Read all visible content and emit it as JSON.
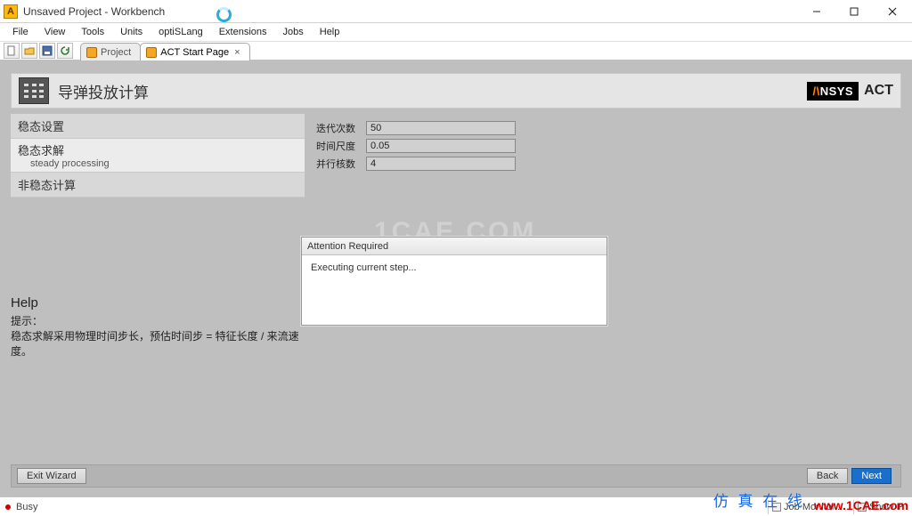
{
  "window": {
    "title": "Unsaved Project - Workbench",
    "app_icon_letter": "A"
  },
  "menu": {
    "file": "File",
    "view": "View",
    "tools": "Tools",
    "units": "Units",
    "optislang": "optiSLang",
    "extensions": "Extensions",
    "jobs": "Jobs",
    "help": "Help"
  },
  "tabs": {
    "project": "Project",
    "act_start": "ACT Start Page"
  },
  "header": {
    "title": "导弹投放计算",
    "act": "ACT"
  },
  "sidebar": {
    "item0": "稳态设置",
    "item1_title": "稳态求解",
    "item1_sub": "steady processing",
    "item2": "非稳态计算"
  },
  "form": {
    "iterations_label": "迭代次数",
    "iterations_value": "50",
    "time_scale_label": "时间尺度",
    "time_scale_value": "0.05",
    "parallel_label": "并行核数",
    "parallel_value": "4"
  },
  "dialog": {
    "title": "Attention Required",
    "body": "Executing current step..."
  },
  "help": {
    "title": "Help",
    "line1": "提示：",
    "line2": "稳态求解采用物理时间步长，预估时间步 = 特征长度 / 来流速度。"
  },
  "buttons": {
    "exit": "Exit Wizard",
    "back": "Back",
    "next": "Next"
  },
  "status": {
    "busy": "Busy",
    "job_monitor": "Job Monitor...",
    "show_progress": "Show P"
  },
  "watermark": {
    "cn": "仿 真 在 线",
    "url": "www.1CAE.com",
    "bg": "1CAE.COM"
  }
}
